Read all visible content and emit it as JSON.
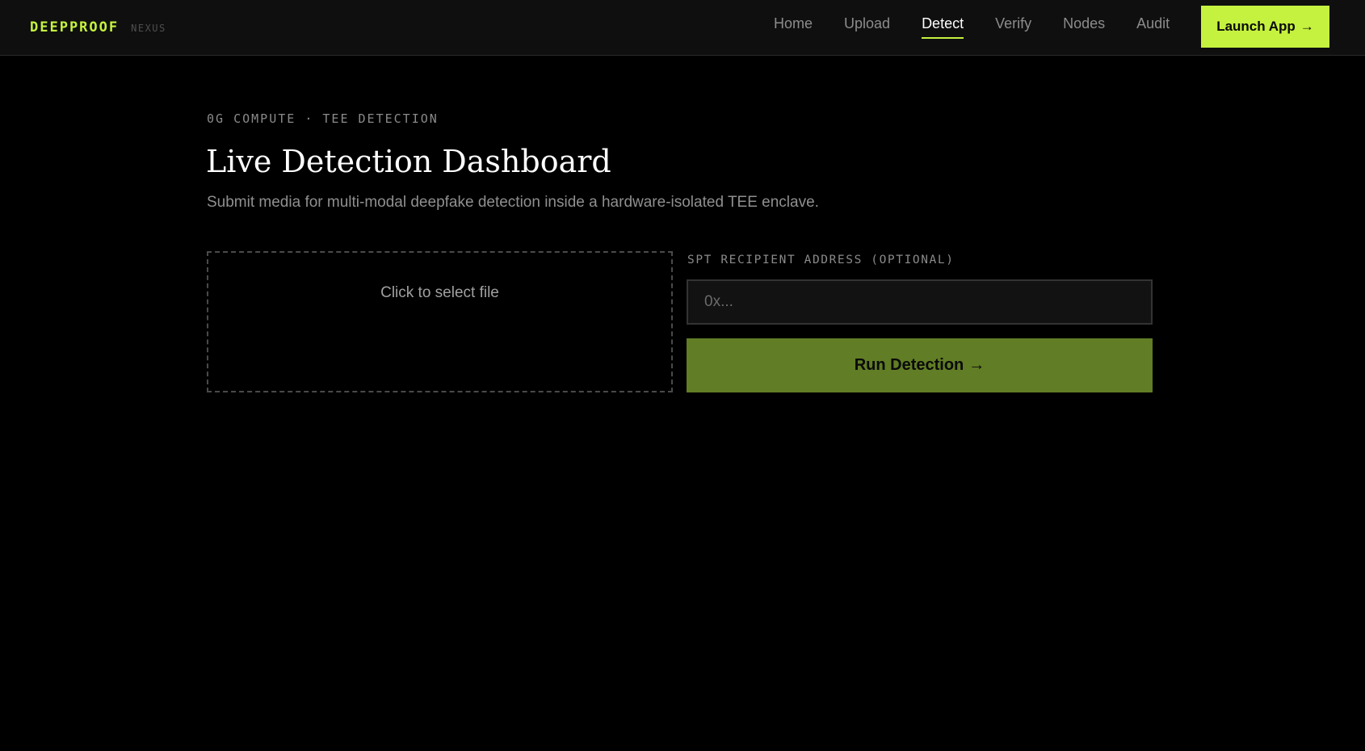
{
  "brand": {
    "name": "DEEPPROOF",
    "sub": "NEXUS"
  },
  "nav": {
    "items": [
      {
        "label": "Home"
      },
      {
        "label": "Upload"
      },
      {
        "label": "Detect"
      },
      {
        "label": "Verify"
      },
      {
        "label": "Nodes"
      },
      {
        "label": "Audit"
      }
    ],
    "active": "Detect",
    "launch_label": "Launch App",
    "launch_icon": "arrow-right-icon"
  },
  "hero": {
    "eyebrow": "0G COMPUTE · TEE DETECTION",
    "title": "Live Detection Dashboard",
    "subtitle": "Submit media for multi-modal deepfake detection inside a hardware-isolated TEE enclave."
  },
  "upload": {
    "prompt": "Click to select file"
  },
  "recipient": {
    "label": "SPT RECIPIENT ADDRESS (OPTIONAL)",
    "value": "",
    "placeholder": "0x..."
  },
  "actions": {
    "run_label": "Run Detection",
    "run_icon": "arrow-right-icon"
  },
  "colors": {
    "accent": "#c5f23f",
    "run_button": "#617d25",
    "background": "#000000",
    "topbar": "#0f0f0f"
  }
}
